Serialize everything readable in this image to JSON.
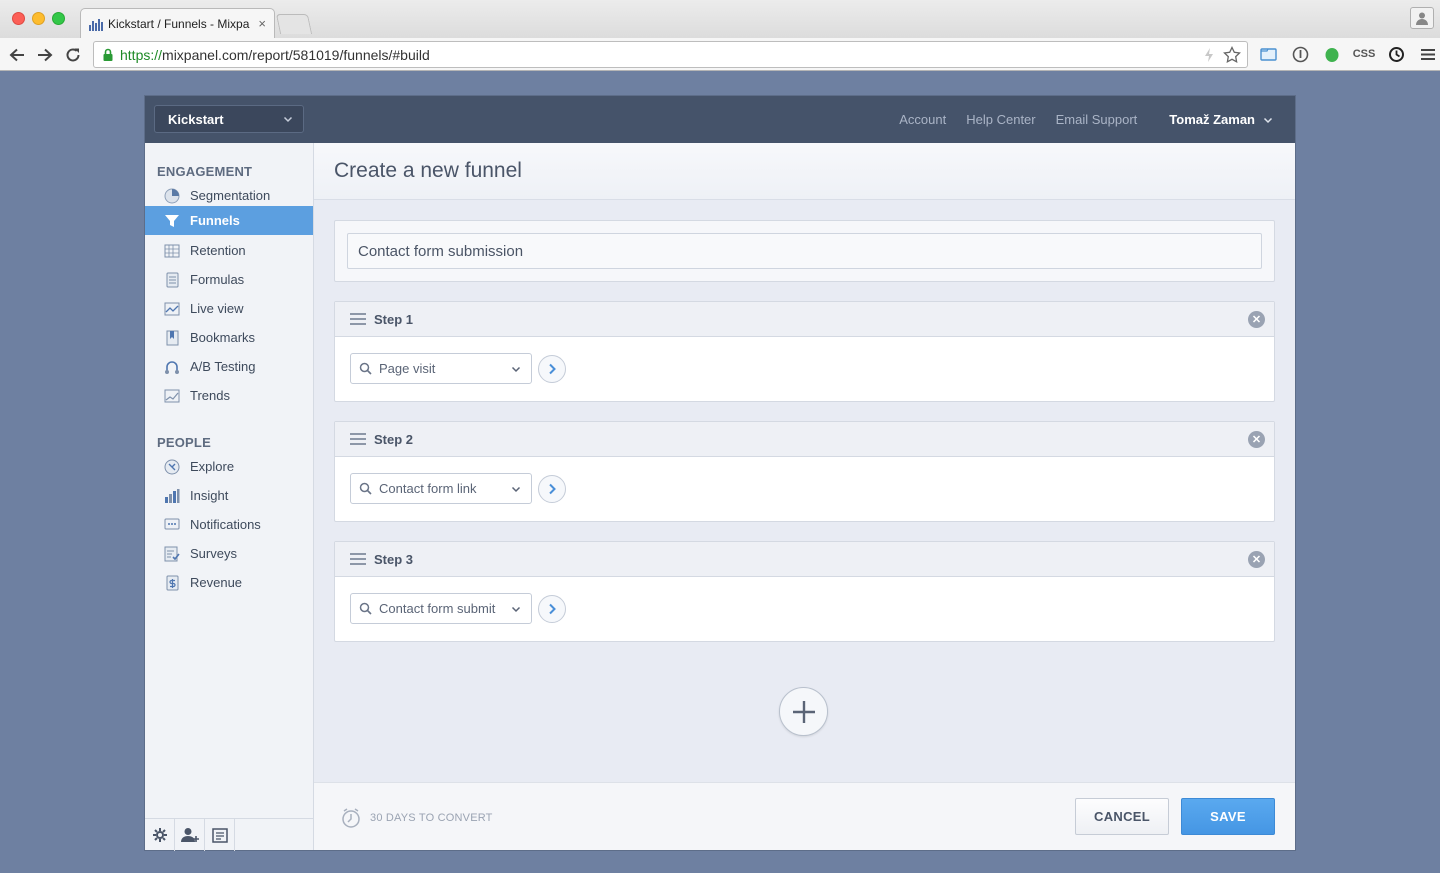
{
  "browser": {
    "tab_title": "Kickstart / Funnels - Mixpa",
    "tab_close": "×",
    "url_scheme": "https://",
    "url_rest": "mixpanel.com/report/581019/funnels/#build",
    "ext_css_label": "CSS"
  },
  "header": {
    "project": "Kickstart",
    "links": [
      "Account",
      "Help Center",
      "Email Support"
    ],
    "user": "Tomaž Zaman"
  },
  "sidebar": {
    "engagement_title": "ENGAGEMENT",
    "engagement_items": [
      {
        "label": "Segmentation",
        "icon": "pie-chart-icon"
      },
      {
        "label": "Funnels",
        "icon": "funnel-icon"
      },
      {
        "label": "Retention",
        "icon": "grid-icon"
      },
      {
        "label": "Formulas",
        "icon": "calculator-icon"
      },
      {
        "label": "Live view",
        "icon": "live-chart-icon"
      },
      {
        "label": "Bookmarks",
        "icon": "bookmark-icon"
      },
      {
        "label": "A/B Testing",
        "icon": "ab-test-icon"
      },
      {
        "label": "Trends",
        "icon": "trend-icon"
      }
    ],
    "people_title": "PEOPLE",
    "people_items": [
      {
        "label": "Explore",
        "icon": "compass-icon"
      },
      {
        "label": "Insight",
        "icon": "bar-chart-icon"
      },
      {
        "label": "Notifications",
        "icon": "chat-icon"
      },
      {
        "label": "Surveys",
        "icon": "checklist-icon"
      },
      {
        "label": "Revenue",
        "icon": "dollar-icon"
      }
    ],
    "active": "Funnels"
  },
  "main": {
    "title": "Create a new funnel",
    "funnel_name": "Contact form submission",
    "steps": [
      {
        "label": "Step 1",
        "event": "Page visit"
      },
      {
        "label": "Step 2",
        "event": "Contact form link"
      },
      {
        "label": "Step 3",
        "event": "Contact form submit"
      }
    ],
    "convert_window": "30 DAYS TO CONVERT",
    "cancel_label": "CANCEL",
    "save_label": "SAVE"
  },
  "colors": {
    "accent": "#5c9fe0",
    "header_bg": "#45536a",
    "page_bg": "#6e80a1"
  }
}
